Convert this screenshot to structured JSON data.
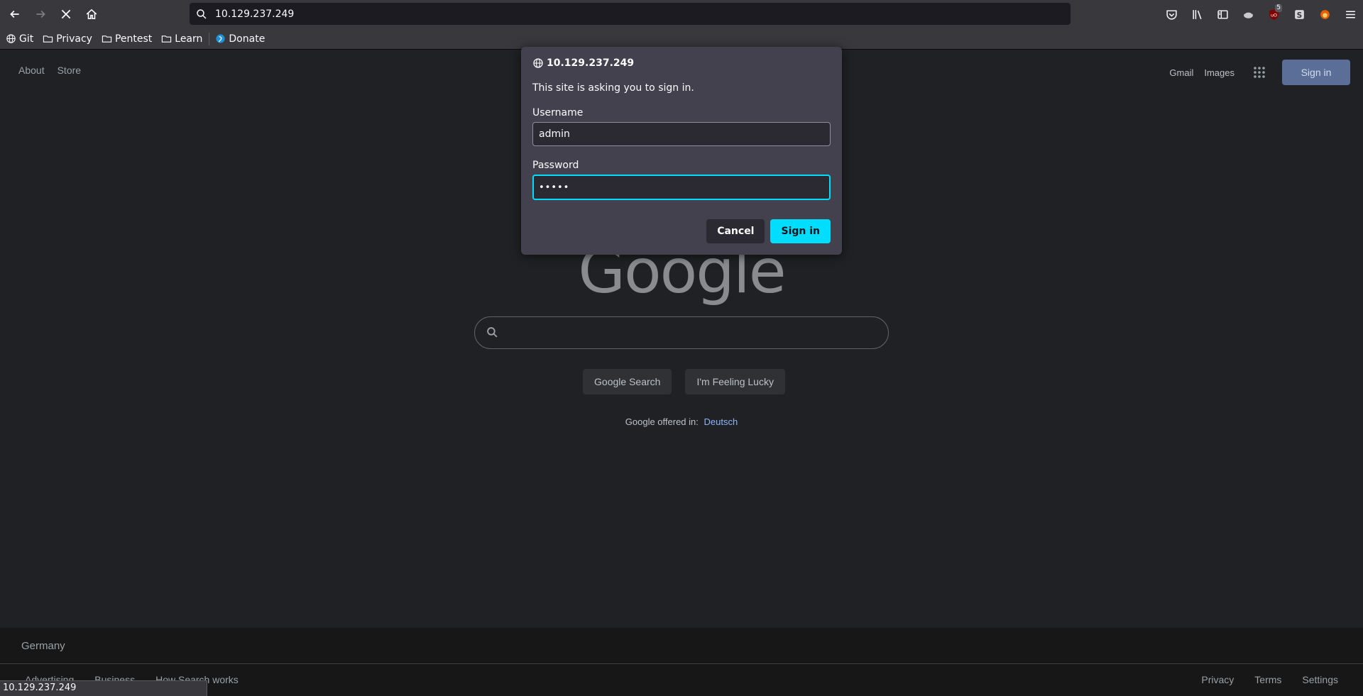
{
  "browser": {
    "url": "10.129.237.249",
    "updates_badge": "5",
    "bookmarks": [
      {
        "label": "Git"
      },
      {
        "label": "Privacy"
      },
      {
        "label": "Pentest"
      },
      {
        "label": "Learn"
      },
      {
        "label": "Donate"
      }
    ],
    "status_url": "10.129.237.249"
  },
  "google": {
    "top_left": {
      "about": "About",
      "store": "Store"
    },
    "top_right": {
      "gmail": "Gmail",
      "images": "Images",
      "sign_in": "Sign in"
    },
    "logo": "Google",
    "buttons": {
      "search": "Google Search",
      "lucky": "I'm Feeling Lucky"
    },
    "offered_in": "Google offered in:",
    "offered_lang": "Deutsch",
    "footer": {
      "country": "Germany",
      "left_links": [
        "Advertising",
        "Business",
        "How Search works"
      ],
      "right_links": [
        "Privacy",
        "Terms",
        "Settings"
      ]
    }
  },
  "auth_dialog": {
    "host": "10.129.237.249",
    "message": "This site is asking you to sign in.",
    "username_label": "Username",
    "username_value": "admin",
    "password_label": "Password",
    "password_masked": "•••••",
    "cancel": "Cancel",
    "sign_in": "Sign in"
  },
  "colors": {
    "accent": "#00ddff",
    "google_signin_bg": "#5a6e97",
    "page_bg": "#202124"
  }
}
